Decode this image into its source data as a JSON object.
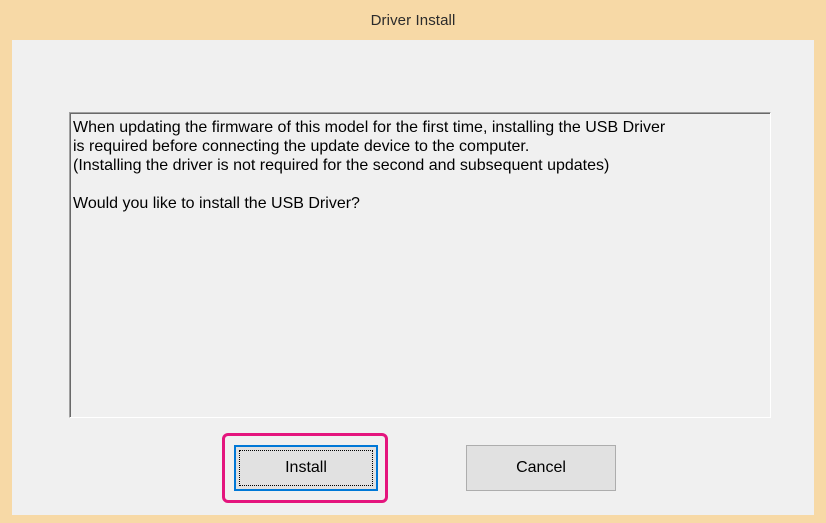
{
  "window": {
    "title": "Driver Install"
  },
  "message": {
    "lines": [
      "When updating the firmware of this model for the first time, installing the USB Driver",
      "is required before connecting the update device to the computer.",
      "(Installing the driver is not required for the second and subsequent updates)",
      "",
      "Would you like to install the USB Driver?"
    ]
  },
  "buttons": {
    "install_label": "Install",
    "cancel_label": "Cancel"
  },
  "colors": {
    "title_bar": "#f7d9a6",
    "dialog_bg": "#f0f0f0",
    "highlight": "#e4157d",
    "focus_border": "#0078d7"
  }
}
